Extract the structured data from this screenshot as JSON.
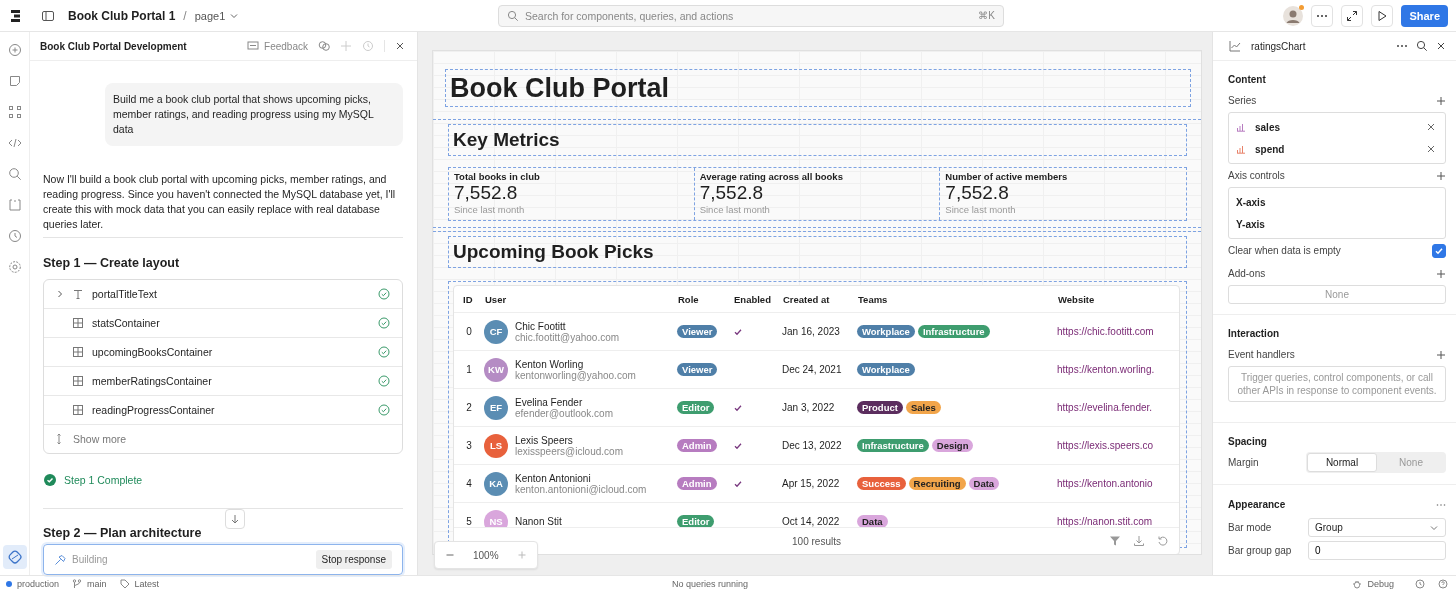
{
  "topbar": {
    "app_name": "Book Club Portal 1",
    "separator": "/",
    "page": "page1",
    "search": {
      "placeholder": "Search for components, queries, and actions"
    },
    "shortcut": "⌘K",
    "share": "Share"
  },
  "chat": {
    "title": "Book Club Portal Development",
    "feedback": "Feedback",
    "prompt": "Build me a book club portal that shows upcoming picks, member ratings, and reading progress using my MySQL data",
    "response": "Now I'll build a book club portal with upcoming picks, member ratings, and reading progress. Since you haven't connected the MySQL database yet, I'll create this with mock data that you can easily replace with real database queries later.",
    "step1": {
      "title": "Step 1 — Create layout",
      "items": [
        {
          "name": "portalTitleText",
          "kind": "text",
          "expandable": true,
          "done": true
        },
        {
          "name": "statsContainer",
          "kind": "container",
          "expandable": false,
          "done": true
        },
        {
          "name": "upcomingBooksContainer",
          "kind": "container",
          "expandable": false,
          "done": true
        },
        {
          "name": "memberRatingsContainer",
          "kind": "container",
          "expandable": false,
          "done": true
        },
        {
          "name": "readingProgressContainer",
          "kind": "container",
          "expandable": false,
          "done": true
        }
      ],
      "show_more": "Show more",
      "status": "Step 1 Complete"
    },
    "step2": {
      "title": "Step 2 — Plan architecture"
    },
    "building": "Building",
    "stop": "Stop response"
  },
  "canvas": {
    "title": "Book Club Portal",
    "metrics_title": "Key Metrics",
    "metrics": [
      {
        "label": "Total books in club",
        "value": "7,552.8",
        "caption": "Since last month"
      },
      {
        "label": "Average rating across all books",
        "value": "7,552.8",
        "caption": "Since last month"
      },
      {
        "label": "Number of active members",
        "value": "7,552.8",
        "caption": "Since last month"
      }
    ],
    "picks_title": "Upcoming Book Picks",
    "table": {
      "columns": [
        "ID",
        "User",
        "Role",
        "Enabled",
        "Created at",
        "Teams",
        "Website"
      ],
      "rows": [
        {
          "id": "0",
          "avatar": {
            "initials": "CF",
            "color": "#5b8db3"
          },
          "name": "Chic Footitt",
          "email": "chic.footitt@yahoo.com",
          "role": {
            "label": "Viewer",
            "color": "#4f7fa8"
          },
          "enabled": true,
          "created": "Jan 16, 2023",
          "teams": [
            {
              "label": "Workplace",
              "color": "#4f7fa8"
            },
            {
              "label": "Infrastructure",
              "color": "#3e9d6f"
            }
          ],
          "website": "https://chic.footitt.com"
        },
        {
          "id": "1",
          "avatar": {
            "initials": "KW",
            "color": "#b58cc4"
          },
          "name": "Kenton Worling",
          "email": "kentonworling@yahoo.com",
          "role": {
            "label": "Viewer",
            "color": "#4f7fa8"
          },
          "enabled": false,
          "created": "Dec 24, 2021",
          "teams": [
            {
              "label": "Workplace",
              "color": "#4f7fa8"
            }
          ],
          "website": "https://kenton.worling."
        },
        {
          "id": "2",
          "avatar": {
            "initials": "EF",
            "color": "#5b8db3"
          },
          "name": "Evelina Fender",
          "email": "efender@outlook.com",
          "role": {
            "label": "Editor",
            "color": "#3e9d6f"
          },
          "enabled": true,
          "created": "Jan 3, 2022",
          "teams": [
            {
              "label": "Product",
              "color": "#5b2d5e"
            },
            {
              "label": "Sales",
              "color": "#f2a54a"
            }
          ],
          "website": "https://evelina.fender."
        },
        {
          "id": "3",
          "avatar": {
            "initials": "LS",
            "color": "#e8613c"
          },
          "name": "Lexis Speers",
          "email": "lexisspeers@icloud.com",
          "role": {
            "label": "Admin",
            "color": "#b77cc0"
          },
          "enabled": true,
          "created": "Dec 13, 2022",
          "teams": [
            {
              "label": "Infrastructure",
              "color": "#3e9d6f"
            },
            {
              "label": "Design",
              "color": "#d9a6dc"
            }
          ],
          "website": "https://lexis.speers.co"
        },
        {
          "id": "4",
          "avatar": {
            "initials": "KA",
            "color": "#5b8db3"
          },
          "name": "Kenton Antonioni",
          "email": "kenton.antonioni@icloud.com",
          "role": {
            "label": "Admin",
            "color": "#b77cc0"
          },
          "enabled": true,
          "created": "Apr 15, 2022",
          "teams": [
            {
              "label": "Success",
              "color": "#e8613c"
            },
            {
              "label": "Recruiting",
              "color": "#f2a54a"
            },
            {
              "label": "Data",
              "color": "#d9a6dc"
            }
          ],
          "website": "https://kenton.antonio"
        },
        {
          "id": "5",
          "avatar": {
            "initials": "NS",
            "color": "#d9a6dc"
          },
          "name": "Nanon Stit",
          "role": {
            "label": "Editor",
            "color": "#3e9d6f"
          },
          "enabled": false,
          "created": "Oct 14, 2022",
          "teams": [
            {
              "label": "Data",
              "color": "#d9a6dc"
            }
          ],
          "website": "https://nanon.stit.com"
        }
      ],
      "footer": "100 results"
    },
    "zoom": "100%"
  },
  "inspector": {
    "title": "ratingsChart",
    "content": "Content",
    "series_label": "Series",
    "series": [
      {
        "name": "sales",
        "color": "#b77cc0"
      },
      {
        "name": "spend",
        "color": "#e8836a"
      }
    ],
    "axis_label": "Axis controls",
    "axes": [
      "X-axis",
      "Y-axis"
    ],
    "clear_label": "Clear when data is empty",
    "clear_checked": true,
    "addons_label": "Add-ons",
    "addons_value": "None",
    "interaction": "Interaction",
    "handlers_label": "Event handlers",
    "handlers_placeholder": "Trigger queries, control components, or call other APIs in response to component events.",
    "spacing": "Spacing",
    "margin_label": "Margin",
    "margin_options": [
      {
        "label": "Normal",
        "selected": true
      },
      {
        "label": "None",
        "selected": false
      }
    ],
    "appearance": "Appearance",
    "bar_mode_label": "Bar mode",
    "bar_mode": "Group",
    "gap_label": "Bar group gap",
    "gap": "0"
  },
  "status_bar": {
    "environment": "production",
    "branch": "main",
    "tag": "Latest",
    "queries": "No queries running",
    "debug": "Debug"
  }
}
